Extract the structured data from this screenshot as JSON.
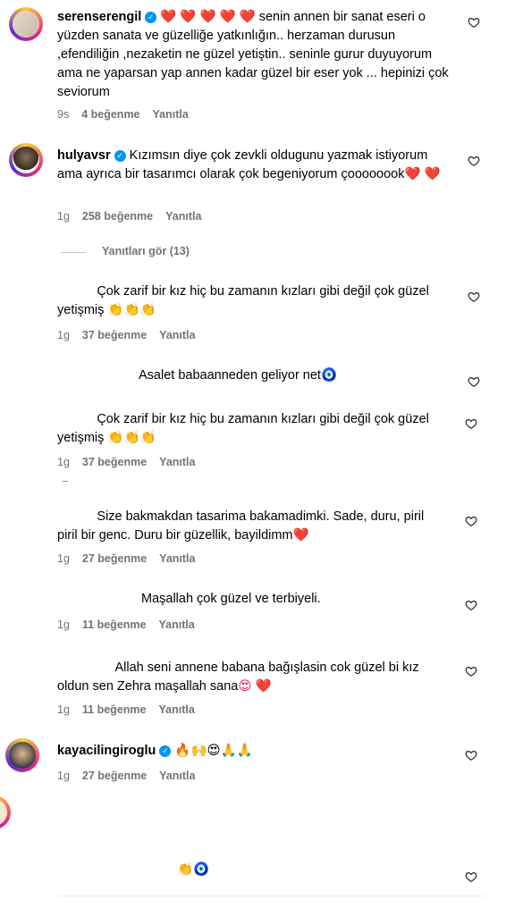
{
  "comments": [
    {
      "user": "serenserengil",
      "hearts": "❤️ ❤️ ❤️ ❤️ ❤️",
      "text": "senin annen bir sanat eseri o yüzden sanata ve güzelliğe yatkınlığın.. herzaman durusun ,efendiliğin ,nezaketin ne güzel yetiştin.. seninle gurur duyuyorum ama ne yaparsan yap annen kadar güzel bir eser yok ... hepinizi çok seviorum",
      "time": "9s",
      "likes": "4 beğenme",
      "reply": "Yanıtla"
    },
    {
      "user": "hulyavsr",
      "text": "Kızımsın diye çok zevkli oldugunu yazmak istiyorum ama ayrıca bir tasarımcı olarak çok begeniyorum çoooooook",
      "emoji": "❤️ ❤️",
      "time": "1g",
      "likes": "258 beğenme",
      "reply": "Yanıtla",
      "view_replies": "Yanıtları gör (13)"
    },
    {
      "text": "Çok zarif bir kız hiç bu zamanın kızları gibi değil çok güzel yetişmiş",
      "emoji": "👏👏👏",
      "time": "1g",
      "likes": "37 beğenme",
      "reply": "Yanıtla"
    },
    {
      "text": "Asalet babaanneden geliyor net",
      "emoji": "🧿"
    },
    {
      "text": "Çok zarif bir kız hiç bu zamanın kızları gibi değil çok güzel yetişmiş",
      "emoji": "👏👏👏",
      "time": "1g",
      "likes": "37 beğenme",
      "reply": "Yanıtla"
    },
    {
      "text": "Size bakmakdan tasarima bakamadimki. Sade, duru, piril piril bir genc. Duru bir güzellik, bayildimm",
      "emoji": "❤️",
      "time": "1g",
      "likes": "27 beğenme",
      "reply": "Yanıtla"
    },
    {
      "text": "Maşallah çok güzel ve terbiyeli.",
      "time": "1g",
      "likes": "11 beğenme",
      "reply": "Yanıtla"
    },
    {
      "text": "Allah seni annene babana bağışlasin cok güzel bi kız oldun sen Zehra maşallah sana",
      "emoji": "😍 ❤️",
      "time": "1g",
      "likes": "11 beğenme",
      "reply": "Yanıtla"
    },
    {
      "user": "kayacilingiroglu",
      "emoji": "🔥🙌😍🙏🙏",
      "time": "1g",
      "likes": "27 beğenme",
      "reply": "Yanıtla"
    },
    {
      "emoji": "👏🧿"
    }
  ],
  "colors": {
    "meta": "#737373",
    "verified": "#0095f6",
    "heart": "#e0245e"
  }
}
